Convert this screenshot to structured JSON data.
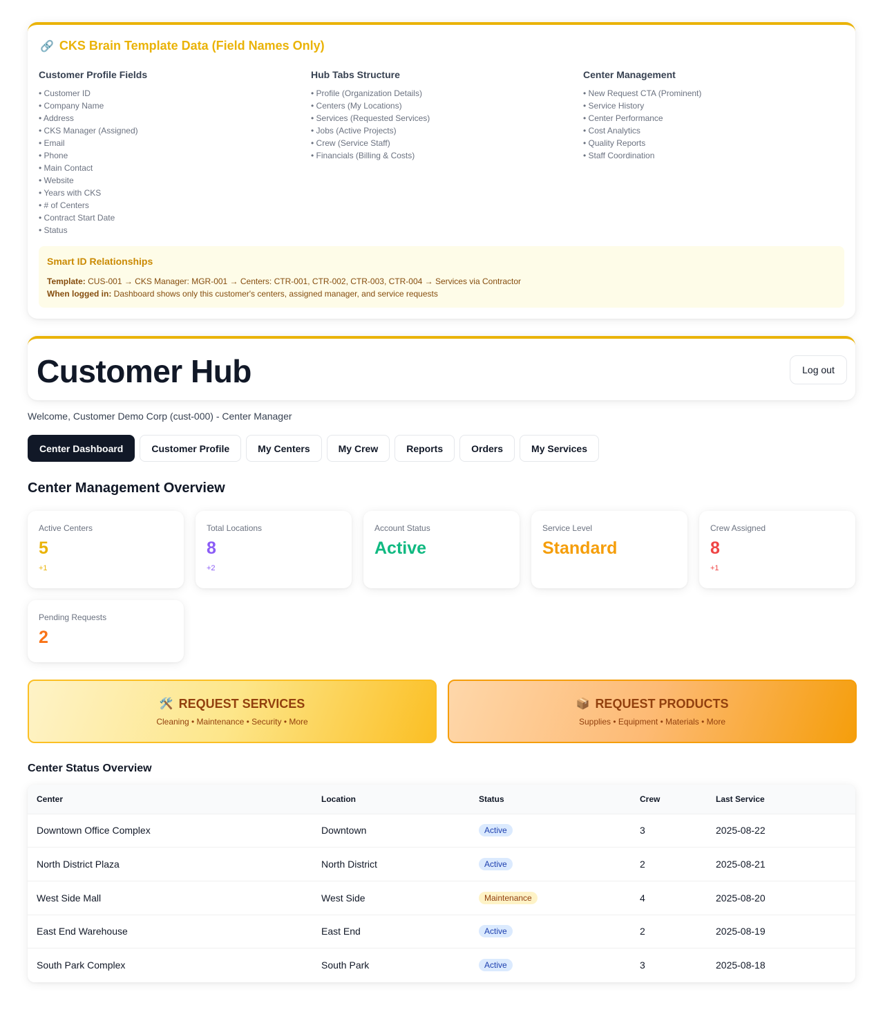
{
  "template": {
    "icon": "link-icon",
    "title": "CKS Brain Template Data (Field Names Only)",
    "columns": [
      {
        "heading": "Customer Profile Fields",
        "items": [
          "Customer ID",
          "Company Name",
          "Address",
          "CKS Manager (Assigned)",
          "Email",
          "Phone",
          "Main Contact",
          "Website",
          "Years with CKS",
          "# of Centers",
          "Contract Start Date",
          "Status"
        ]
      },
      {
        "heading": "Hub Tabs Structure",
        "items": [
          "Profile (Organization Details)",
          "Centers (My Locations)",
          "Services (Requested Services)",
          "Jobs (Active Projects)",
          "Crew (Service Staff)",
          "Financials (Billing & Costs)"
        ]
      },
      {
        "heading": "Center Management",
        "items": [
          "New Request CTA (Prominent)",
          "Service History",
          "Center Performance",
          "Cost Analytics",
          "Quality Reports",
          "Staff Coordination"
        ]
      }
    ],
    "smart": {
      "heading": "Smart ID Relationships",
      "template_label": "Template:",
      "template_text": "CUS-001 → CKS Manager: MGR-001 → Centers: CTR-001, CTR-002, CTR-003, CTR-004 → Services via Contractor",
      "logged_label": "When logged in:",
      "logged_text": "Dashboard shows only this customer's centers, assigned manager, and service requests"
    }
  },
  "header": {
    "title": "Customer Hub",
    "logout": "Log out"
  },
  "welcome": "Welcome, Customer Demo Corp (cust-000) - Center Manager",
  "tabs": [
    "Center Dashboard",
    "Customer Profile",
    "My Centers",
    "My Crew",
    "Reports",
    "Orders",
    "My Services"
  ],
  "overview": {
    "title": "Center Management Overview",
    "stats": [
      {
        "label": "Active Centers",
        "value": "5",
        "delta": "+1",
        "color": "#eab308"
      },
      {
        "label": "Total Locations",
        "value": "8",
        "delta": "+2",
        "color": "#8b5cf6"
      },
      {
        "label": "Account Status",
        "value": "Active",
        "delta": "",
        "color": "#10b981"
      },
      {
        "label": "Service Level",
        "value": "Standard",
        "delta": "",
        "color": "#f59e0b"
      },
      {
        "label": "Crew Assigned",
        "value": "8",
        "delta": "+1",
        "color": "#ef4444"
      },
      {
        "label": "Pending Requests",
        "value": "2",
        "delta": "",
        "color": "#f97316"
      }
    ]
  },
  "cta": {
    "services": {
      "icon": "tools-icon",
      "title": "REQUEST SERVICES",
      "subtitle": "Cleaning • Maintenance • Security • More"
    },
    "products": {
      "icon": "package-icon",
      "title": "REQUEST PRODUCTS",
      "subtitle": "Supplies • Equipment • Materials • More"
    }
  },
  "status_table": {
    "title": "Center Status Overview",
    "columns": [
      "Center",
      "Location",
      "Status",
      "Crew",
      "Last Service"
    ],
    "rows": [
      {
        "center": "Downtown Office Complex",
        "location": "Downtown",
        "status": "Active",
        "crew": "3",
        "last": "2025-08-22"
      },
      {
        "center": "North District Plaza",
        "location": "North District",
        "status": "Active",
        "crew": "2",
        "last": "2025-08-21"
      },
      {
        "center": "West Side Mall",
        "location": "West Side",
        "status": "Maintenance",
        "crew": "4",
        "last": "2025-08-20"
      },
      {
        "center": "East End Warehouse",
        "location": "East End",
        "status": "Active",
        "crew": "2",
        "last": "2025-08-19"
      },
      {
        "center": "South Park Complex",
        "location": "South Park",
        "status": "Active",
        "crew": "3",
        "last": "2025-08-18"
      }
    ]
  }
}
